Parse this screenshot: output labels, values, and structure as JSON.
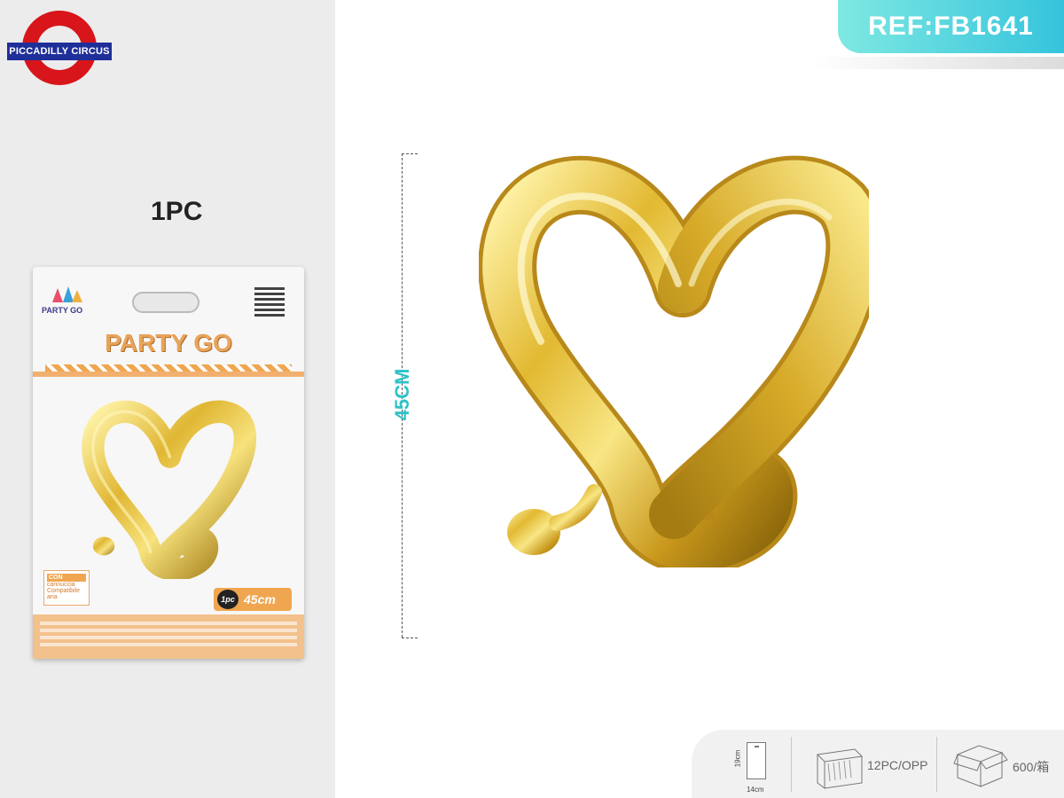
{
  "logo": {
    "text": "PICCADILLY CIRCUS"
  },
  "quantity_label": "1PC",
  "package": {
    "brand_small": "PARTY GO",
    "brand_big": "PARTY GO",
    "tag_con_line1": "CON",
    "tag_con_line2": "cannuccia",
    "tag_con_line3": "Compatibile",
    "tag_con_line4": "aria",
    "size_pc": "1pc",
    "size": "45cm"
  },
  "ref": "REF:FB1641",
  "dimension_label": "45CM",
  "info": {
    "bag_height": "19cm",
    "bag_width": "14cm",
    "per_pack": "12PC/OPP",
    "per_box": "600/箱"
  },
  "colors": {
    "gold": "#d9b32e",
    "gold_light": "#f4e07a",
    "gold_dark": "#a47c12",
    "accent_teal": "#35c4dc",
    "logo_red": "#d8151b",
    "logo_blue": "#1f2f9a"
  }
}
